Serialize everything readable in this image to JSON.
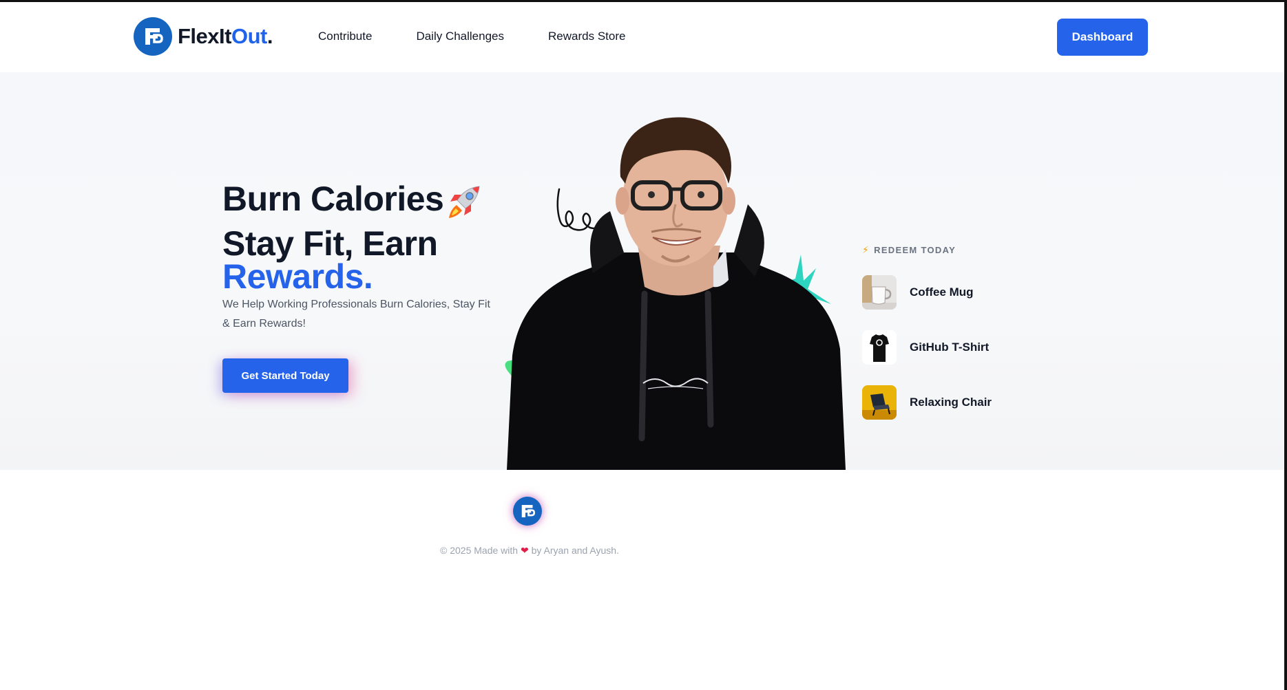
{
  "nav": {
    "brand_main": "FlexIt",
    "brand_accent": "Out",
    "brand_dot": ".",
    "links": [
      "Contribute",
      "Daily Challenges",
      "Rewards Store"
    ],
    "dashboard_label": "Dashboard",
    "logo_icon": "fb-monogram-icon"
  },
  "hero": {
    "line1": "Burn Calories",
    "line2": "Stay Fit, Earn",
    "line3": "Rewards.",
    "rocket_icon": "rocket-emoji-icon",
    "subtext": "We Help Working Professionals Burn Calories, Stay Fit & Earn Rewards!",
    "cta_label": "Get Started Today"
  },
  "redeem": {
    "title": "REDEEM TODAY",
    "title_icon": "lightning-bolt-icon",
    "items": [
      {
        "name": "Coffee Mug",
        "icon": "coffee-mug-thumbnail"
      },
      {
        "name": "GitHub T-Shirt",
        "icon": "github-tshirt-thumbnail"
      },
      {
        "name": "Relaxing Chair",
        "icon": "relaxing-chair-thumbnail"
      }
    ]
  },
  "footer": {
    "copyright_prefix": "© 2025 Made with",
    "copyright_suffix": "by Aryan and Ayush.",
    "heart_icon": "heart-icon"
  },
  "colors": {
    "accent": "#2563eb",
    "logo_blue": "#1565c0",
    "heading": "#111827",
    "muted": "#6b7280"
  }
}
